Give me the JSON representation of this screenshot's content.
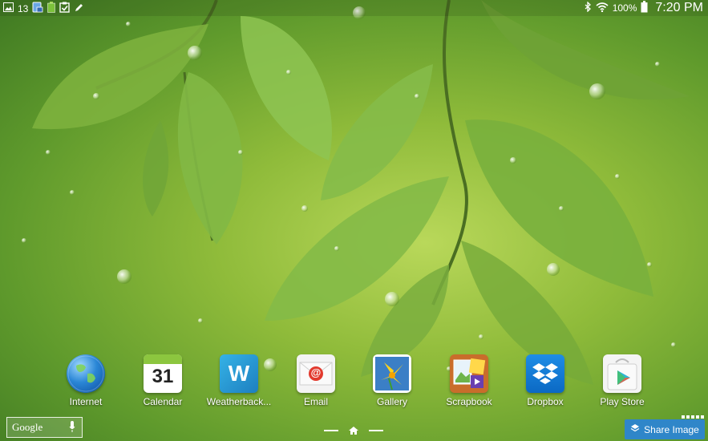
{
  "status_bar": {
    "notification_count": "13",
    "battery_percent": "100%",
    "time": "7:20 PM"
  },
  "dock": [
    {
      "label": "Internet",
      "icon": "globe-icon"
    },
    {
      "label": "Calendar",
      "icon": "calendar-icon",
      "icon_text": "31"
    },
    {
      "label": "Weatherback...",
      "icon": "weatherbackground-icon",
      "icon_text": "W"
    },
    {
      "label": "Email",
      "icon": "email-icon",
      "icon_text": "@"
    },
    {
      "label": "Gallery",
      "icon": "gallery-flower-icon"
    },
    {
      "label": "Scrapbook",
      "icon": "scrapbook-icon"
    },
    {
      "label": "Dropbox",
      "icon": "dropbox-icon"
    },
    {
      "label": "Play Store",
      "icon": "play-store-icon"
    }
  ],
  "google_search": {
    "label": "Google"
  },
  "share_button": {
    "label": "Share Image"
  },
  "colors": {
    "accent": "#2f86c9",
    "wallpaper_green": "#8fbb3a"
  }
}
